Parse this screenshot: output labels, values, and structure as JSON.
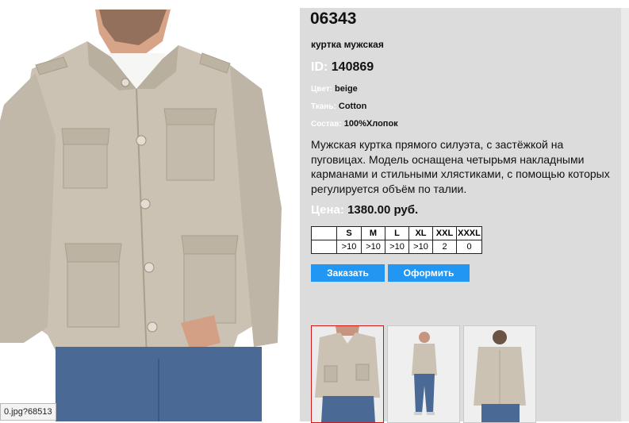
{
  "product": {
    "code": "06343",
    "subtitle": "куртка мужская",
    "id_label": "ID:",
    "id_value": "140869",
    "attributes": [
      {
        "label": "Цвет:",
        "value": "beige"
      },
      {
        "label": "Ткань:",
        "value": "Cotton"
      },
      {
        "label": "Состав:",
        "value": "100%Хлопок"
      }
    ],
    "description": "Мужская куртка прямого силуэта, с застёжкой на пуговицах. Модель оснащена четырьмя накладными карманами и стильными хлястиками, с помощью которых регулируется объём по талии.",
    "price_label": "Цена:",
    "price_value": "1380.00 руб."
  },
  "sizes": {
    "headers": [
      "",
      "S",
      "M",
      "L",
      "XL",
      "XXL",
      "XXXL"
    ],
    "stock": [
      "",
      ">10",
      ">10",
      ">10",
      ">10",
      "2",
      "0"
    ]
  },
  "buttons": {
    "order": "Заказать",
    "checkout": "Оформить"
  },
  "status_bar": {
    "url": "0.jpg?68513"
  },
  "colors": {
    "panel_bg": "#dcdcdc",
    "button_blue": "#2196f3",
    "active_thumb_border": "#d01818",
    "jacket": "#cbc2b4",
    "jeans": "#4a6a95"
  },
  "icons": [
    "product-photo",
    "thumbnail-front",
    "thumbnail-full",
    "thumbnail-back"
  ]
}
